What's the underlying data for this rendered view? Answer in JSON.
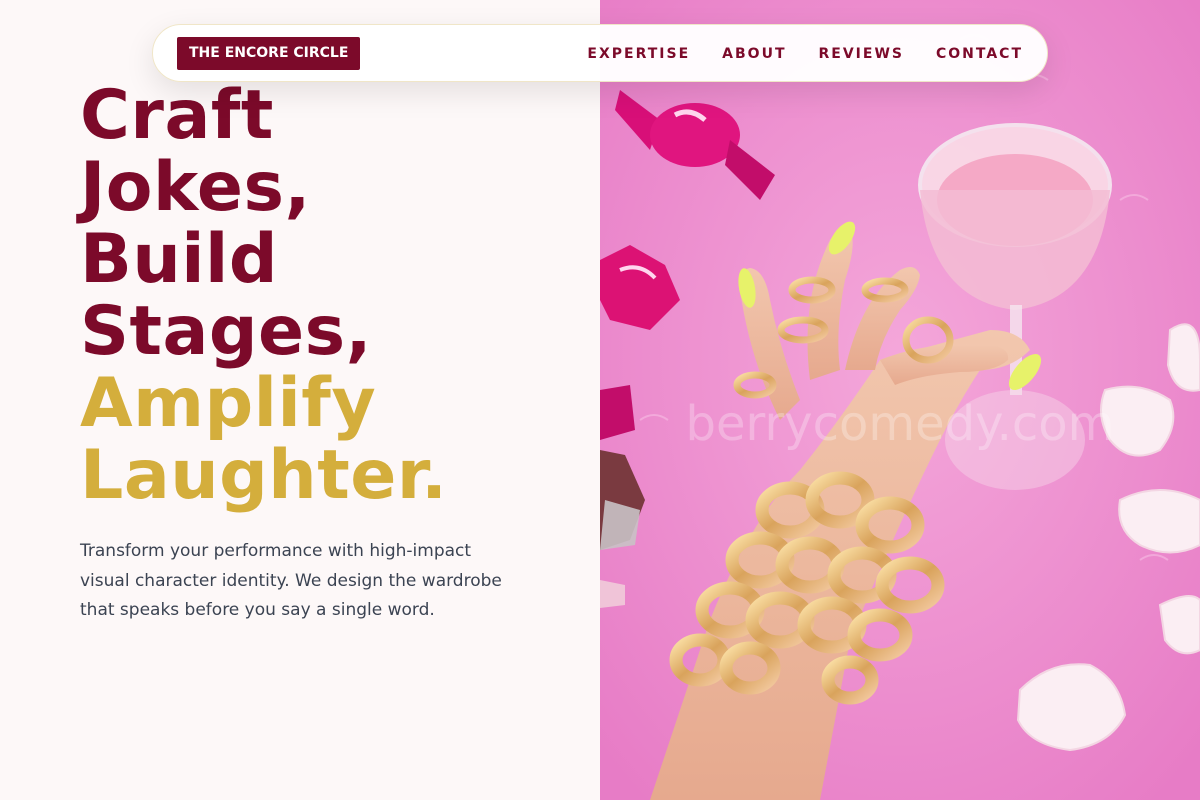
{
  "brand": {
    "logo_text": "THE ENCORE CIRCLE"
  },
  "nav": {
    "items": [
      {
        "label": "EXPERTISE"
      },
      {
        "label": "ABOUT"
      },
      {
        "label": "REVIEWS"
      },
      {
        "label": "CONTACT"
      }
    ]
  },
  "hero": {
    "title_lines_dark": [
      "Craft",
      "Jokes,",
      "Build",
      "Stages,"
    ],
    "title_lines_gold": [
      "Amplify",
      "Laughter."
    ],
    "description": "Transform your performance with high-impact visual character identity. We design the wardrobe that speaks before you say a single word."
  },
  "photo": {
    "watermark_text": "berrycomedy.com"
  },
  "colors": {
    "brand_dark": "#7c0a2a",
    "brand_gold": "#d4ae3c",
    "photo_background": "#ef8fcf"
  }
}
